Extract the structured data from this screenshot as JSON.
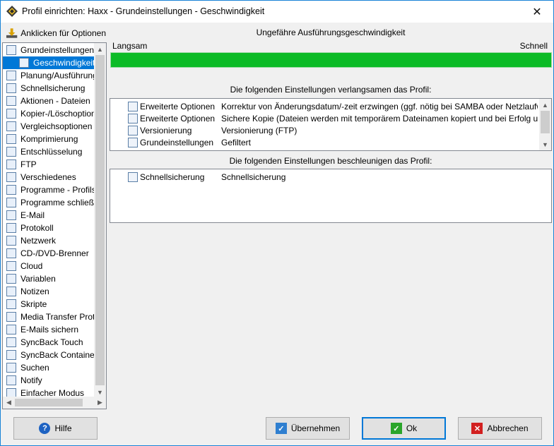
{
  "window": {
    "title": "Profil einrichten: Haxx - Grundeinstellungen - Geschwindigkeit",
    "close_glyph": "✕"
  },
  "sidebar": {
    "options_button_label": "Anklicken für Optionen",
    "items": [
      {
        "label": "Grundeinstellungen",
        "icon": "check-list-icon"
      },
      {
        "label": "Geschwindigkeit",
        "icon": "bar-chart-icon",
        "selected": true,
        "sub": true
      },
      {
        "label": "Planung/Ausführung",
        "icon": "schedule-icon"
      },
      {
        "label": "Schnellsicherung",
        "icon": "fast-backup-icon"
      },
      {
        "label": "Aktionen - Dateien",
        "icon": "file-actions-icon"
      },
      {
        "label": "Kopier-/Löschoptionen",
        "icon": "copy-delete-icon"
      },
      {
        "label": "Vergleichsoptionen",
        "icon": "compare-icon"
      },
      {
        "label": "Komprimierung",
        "icon": "compress-icon"
      },
      {
        "label": "Entschlüsselung",
        "icon": "decrypt-icon"
      },
      {
        "label": "FTP",
        "icon": "ftp-icon"
      },
      {
        "label": "Verschiedenes",
        "icon": "misc-icon"
      },
      {
        "label": "Programme - Profilstart",
        "icon": "programs-icon"
      },
      {
        "label": "Programme schließen",
        "icon": "programs-close-icon"
      },
      {
        "label": "E-Mail",
        "icon": "email-icon"
      },
      {
        "label": "Protokoll",
        "icon": "log-icon"
      },
      {
        "label": "Netzwerk",
        "icon": "network-icon"
      },
      {
        "label": "CD-/DVD-Brenner",
        "icon": "disc-icon"
      },
      {
        "label": "Cloud",
        "icon": "cloud-icon"
      },
      {
        "label": "Variablen",
        "icon": "variables-icon"
      },
      {
        "label": "Notizen",
        "icon": "notes-icon"
      },
      {
        "label": "Skripte",
        "icon": "scripts-icon"
      },
      {
        "label": "Media Transfer Protocol",
        "icon": "mtp-icon"
      },
      {
        "label": "E-Mails sichern",
        "icon": "email-backup-icon"
      },
      {
        "label": "SyncBack Touch",
        "icon": "syncback-touch-icon"
      },
      {
        "label": "SyncBack Container",
        "icon": "syncback-container-icon"
      },
      {
        "label": "Suchen",
        "icon": "search-icon"
      },
      {
        "label": "Notify",
        "icon": "notify-icon"
      },
      {
        "label": "Einfacher Modus",
        "icon": "simple-mode-icon"
      }
    ]
  },
  "speed": {
    "title": "Ungefähre Ausführungsgeschwindigkeit",
    "slow_label": "Langsam",
    "fast_label": "Schnell",
    "bar_color": "#0cbb26"
  },
  "slowing": {
    "title": "Die folgenden Einstellungen verlangsamen das Profil:",
    "rows": [
      {
        "category": "Erweiterte Optionen",
        "setting": "Korrektur von Änderungsdatum/-zeit erzwingen (ggf. nötig bei SAMBA oder Netzlaufwerken)"
      },
      {
        "category": "Erweiterte Optionen",
        "setting": "Sichere Kopie (Dateien werden mit temporärem Dateinamen kopiert und bei Erfolg umbena..."
      },
      {
        "category": "Versionierung",
        "setting": "Versionierung (FTP)"
      },
      {
        "category": "Grundeinstellungen",
        "setting": "Gefiltert"
      }
    ]
  },
  "speeding": {
    "title": "Die folgenden Einstellungen beschleunigen das Profil:",
    "rows": [
      {
        "category": "Schnellsicherung",
        "setting": "Schnellsicherung"
      }
    ]
  },
  "buttons": {
    "help": "Hilfe",
    "apply": "Übernehmen",
    "ok": "Ok",
    "cancel": "Abbrechen"
  }
}
